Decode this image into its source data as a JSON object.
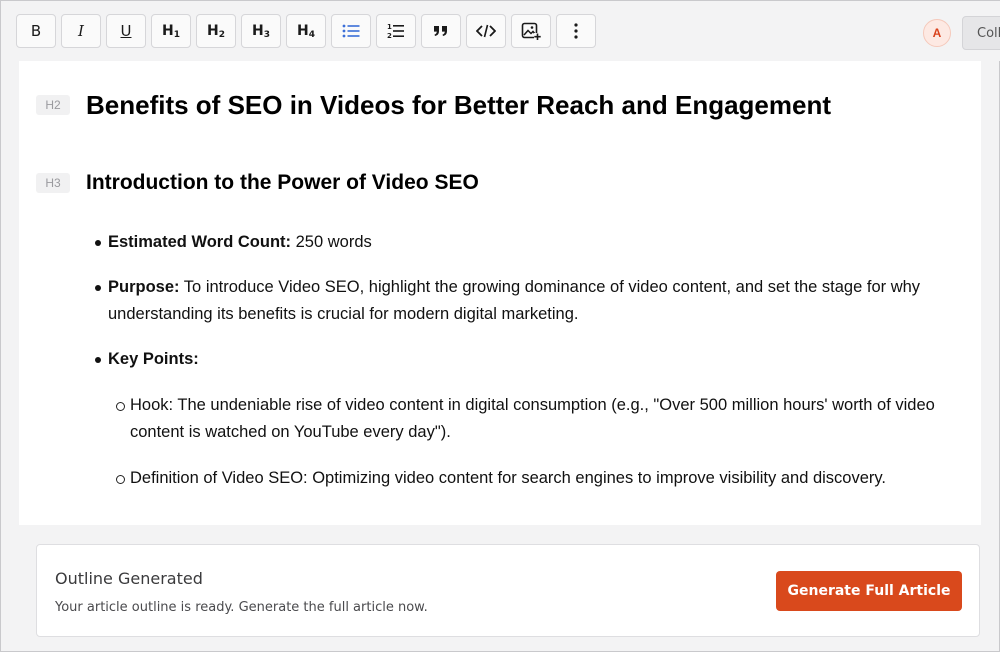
{
  "toolbar": {
    "bold_label": "B",
    "italic_label": "I",
    "underline_label": "U",
    "h1_label": "H",
    "h1_num": "1",
    "h2_label": "H",
    "h2_num": "2",
    "h3_label": "H",
    "h3_num": "3",
    "h4_label": "H",
    "h4_num": "4",
    "icons": [
      "bold-icon",
      "italic-icon",
      "underline-icon",
      "heading-1-icon",
      "heading-2-icon",
      "heading-3-icon",
      "heading-4-icon",
      "bullet-list-icon",
      "numbered-list-icon",
      "quote-icon",
      "code-icon",
      "image-add-icon",
      "more-vertical-icon"
    ],
    "active_color": "#3b6fd8",
    "avatar_initial": "A",
    "collab_label": "Coll"
  },
  "editor": {
    "h2_tag": "H2",
    "h2_title": "Benefits of SEO in Videos for Better Reach and Engagement",
    "h3_tag": "H3",
    "h3_title": "Introduction to the Power of Video SEO",
    "items": [
      {
        "label": "Estimated Word Count:",
        "text": " 250 words"
      },
      {
        "label": "Purpose:",
        "text": " To introduce Video SEO, highlight the growing dominance of video content, and set the stage for why understanding its benefits is crucial for modern digital marketing."
      },
      {
        "label": "Key Points:",
        "text": ""
      }
    ],
    "sub_items": [
      "Hook: The undeniable rise of video content in digital consumption (e.g., \"Over 500 million hours' worth of video content is watched on YouTube every day\").",
      "Definition of Video SEO: Optimizing video content for search engines to improve visibility and discovery."
    ]
  },
  "banner": {
    "title": "Outline Generated",
    "subtitle": "Your article outline is ready. Generate the full article now.",
    "button_label": "Generate Full Article",
    "button_color": "#d9491c"
  }
}
